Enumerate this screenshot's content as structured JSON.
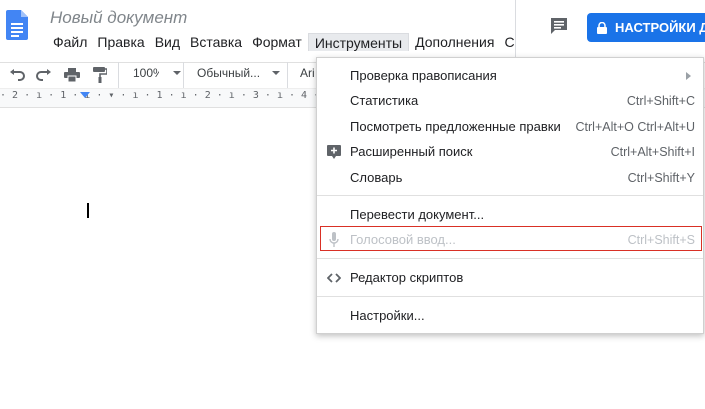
{
  "document": {
    "title": "Новый документ"
  },
  "menubar": {
    "items": [
      "Файл",
      "Правка",
      "Вид",
      "Вставка",
      "Формат",
      "Инструменты",
      "Дополнения",
      "С"
    ],
    "active": "Инструменты"
  },
  "header": {
    "share_label": "НАСТРОЙКИ Д"
  },
  "toolbar": {
    "zoom": "100%",
    "style": "Обычный...",
    "font": "Ari"
  },
  "ruler": {
    "ticks": "· 2 · ı · 1 · ı · ▾ · ı · 1 · ı · 2 · ı · 3 · ı · 4 · ı · 5 · ı · 6 · ı"
  },
  "tools_menu": {
    "items": [
      {
        "label": "Проверка правописания",
        "shortcut": "",
        "has_submenu": true,
        "disabled": false
      },
      {
        "label": "Статистика",
        "shortcut": "Ctrl+Shift+C",
        "disabled": false
      },
      {
        "label": "Посмотреть предложенные правки",
        "shortcut": "Ctrl+Alt+O Ctrl+Alt+U",
        "disabled": false
      },
      {
        "label": "Расширенный поиск",
        "shortcut": "Ctrl+Alt+Shift+I",
        "disabled": false,
        "icon": "explore-icon"
      },
      {
        "label": "Словарь",
        "shortcut": "Ctrl+Shift+Y",
        "disabled": false
      },
      {
        "label": "Перевести документ...",
        "shortcut": "",
        "disabled": false
      },
      {
        "label": "Голосовой ввод...",
        "shortcut": "Ctrl+Shift+S",
        "disabled": true,
        "icon": "microphone-icon"
      },
      {
        "label": "Редактор скриптов",
        "shortcut": "",
        "disabled": false,
        "icon": "code-icon"
      },
      {
        "label": "Настройки...",
        "shortcut": "",
        "disabled": false
      }
    ]
  },
  "colors": {
    "accent": "#1a73e8",
    "highlight": "#d93025"
  }
}
